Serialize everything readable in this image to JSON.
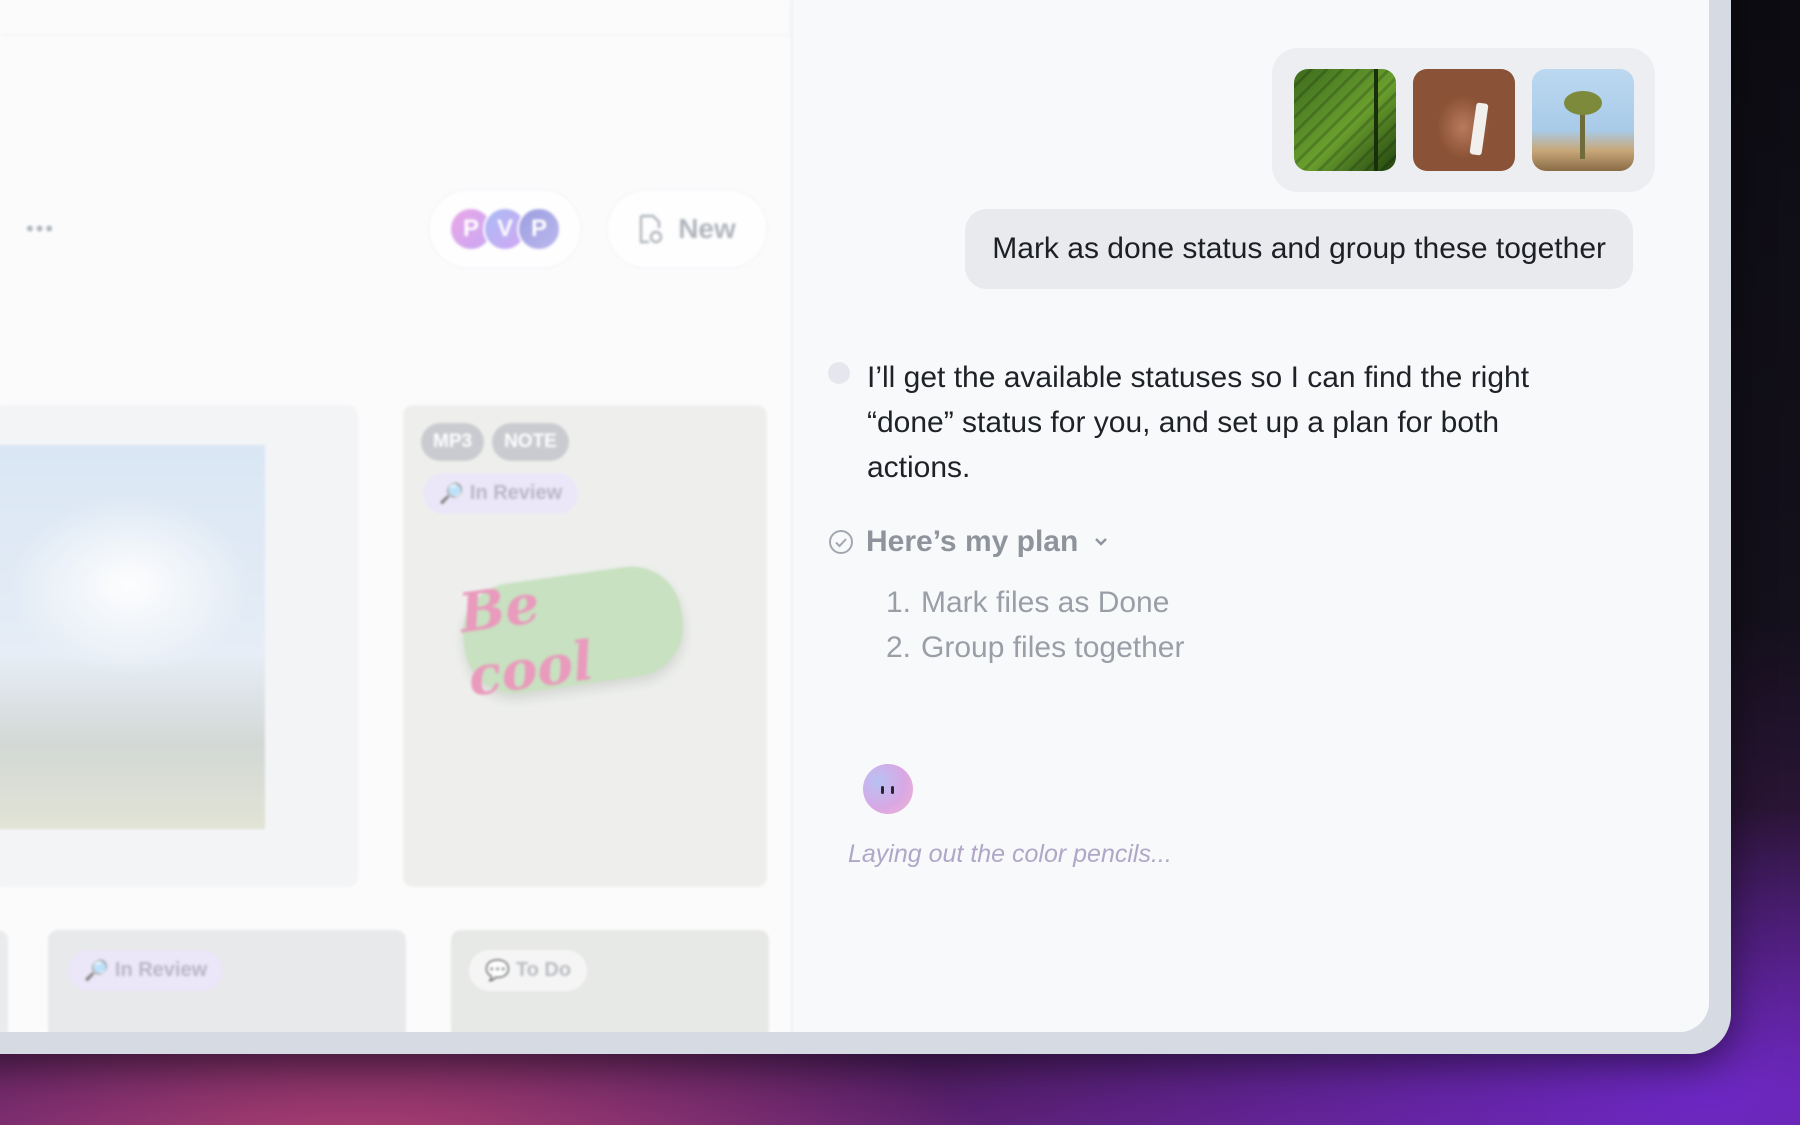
{
  "library": {
    "more_label": "•••",
    "collaborators": [
      "P",
      "V",
      "P"
    ],
    "new_button_label": "New",
    "cards": [
      {
        "tags": [],
        "status": ""
      },
      {
        "tags": [
          "MP3",
          "NOTE"
        ],
        "status": "In Review",
        "art_text": "Be cool"
      }
    ],
    "bottom_cards": [
      {
        "status": ""
      },
      {
        "status": "In Review"
      },
      {
        "status": "To Do"
      }
    ]
  },
  "chat": {
    "attachments": [
      {
        "icon": "leaf-image"
      },
      {
        "icon": "portrait-image"
      },
      {
        "icon": "desert-image"
      }
    ],
    "user_message": "Mark as done status and group these together",
    "assistant_message": "I’ll get the available statuses so I can find the right “done” status for you, and set up a plan for both actions.",
    "plan": {
      "title": "Here’s my plan",
      "steps": [
        {
          "num": "1.",
          "text": "Mark files as Done"
        },
        {
          "num": "2.",
          "text": "Group files together"
        }
      ]
    },
    "thinking_text": "Laying out the color pencils..."
  },
  "colors": {
    "accent_review": "#e6e0f7",
    "bubble": "#e9eaed",
    "thinking": "#b0a7c8"
  }
}
